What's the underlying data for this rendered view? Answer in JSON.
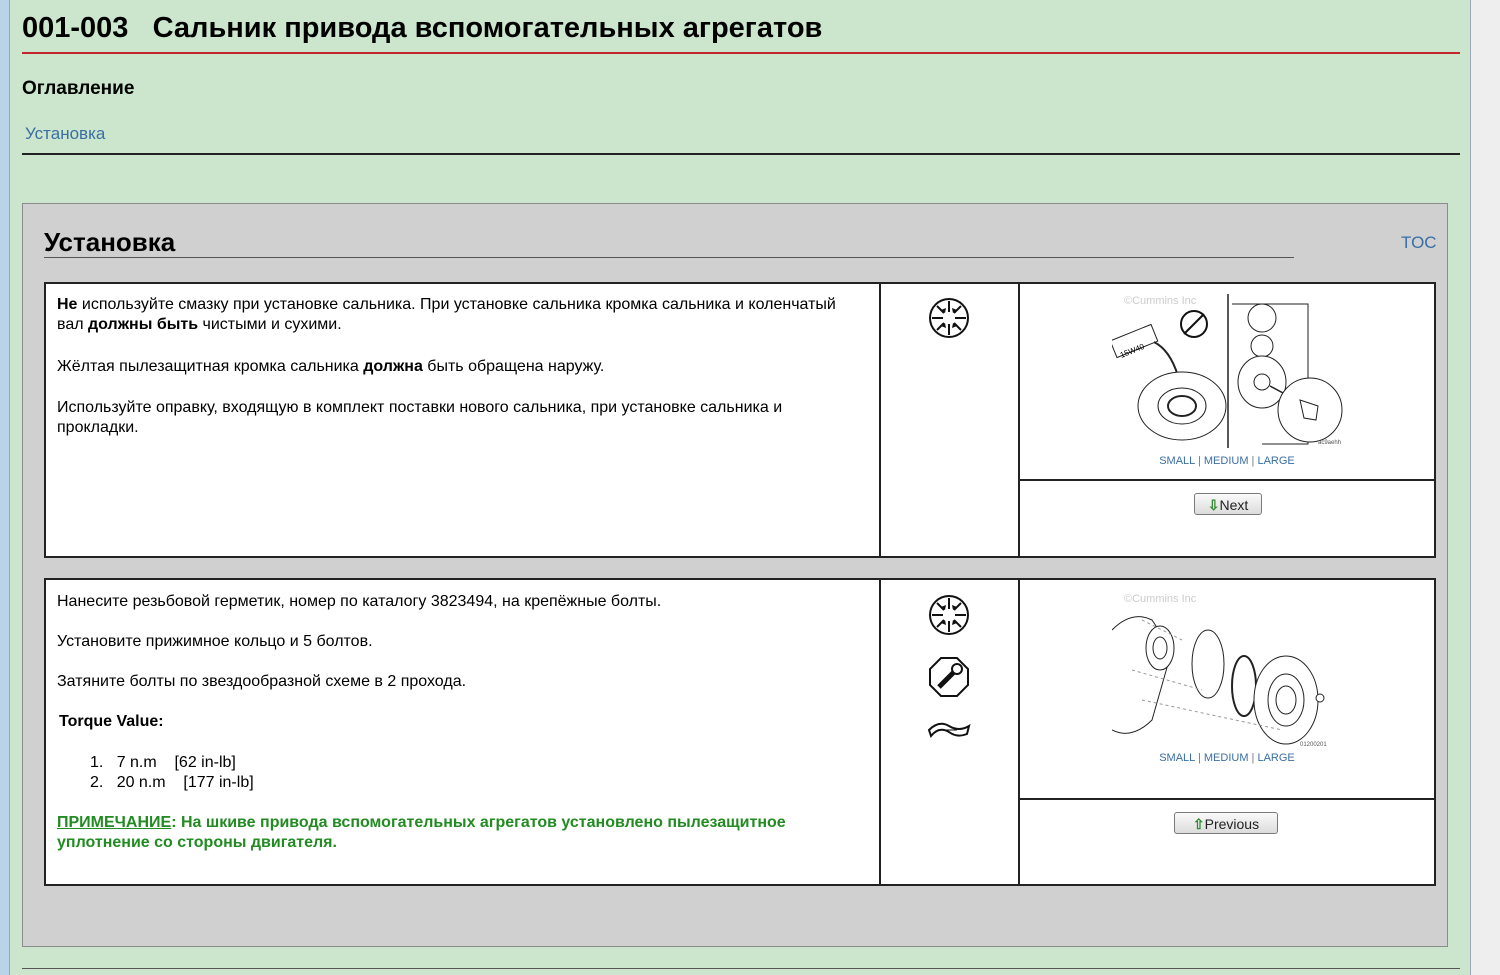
{
  "document": {
    "title_code": "001-003",
    "title_text": "Сальник привода вспомогательных агрегатов",
    "toc_heading": "Оглавление",
    "toc_links": [
      "Установка"
    ]
  },
  "section": {
    "title": "Установка",
    "toc_link": "TOC",
    "size_links": {
      "small": "SMALL",
      "medium": "MEDIUM",
      "large": "LARGE",
      "separator": "|"
    },
    "watermark": "©Cummins Inc",
    "steps": [
      {
        "paragraphs": [
          {
            "bold_start": "Не",
            "text": " используйте смазку при установке сальника. При установке сальника кромка сальника и коленчатый вал ",
            "bold_mid": "должны быть",
            "text_end": " чистыми и сухими."
          },
          {
            "text": "Жёлтая пылезащитная кромка сальника ",
            "bold_mid": "должна",
            "text_end": " быть обращена наружу."
          },
          {
            "text": "Используйте оправку, входящую в комплект поставки нового сальника, при установке сальника и прокладки."
          }
        ],
        "icons": [
          "parts-puzzle-icon"
        ],
        "image_label": "15W40",
        "image_code": "ac9aehh",
        "nav_button": "Next"
      },
      {
        "paragraphs": [
          {
            "text": "Нанесите резьбовой герметик, номер по каталогу 3823494, на крепёжные болты."
          },
          {
            "text": "Установите прижимное кольцо и 5 болтов."
          },
          {
            "text": "Затяните болты по звездообразной схеме в 2 прохода."
          }
        ],
        "torque_title": "Torque Value:",
        "torque_values": [
          {
            "num": "1.",
            "metric": "7 n.m",
            "imperial": "[62 in-lb]"
          },
          {
            "num": "2.",
            "metric": "20 n.m",
            "imperial": "[177 in-lb]"
          }
        ],
        "note_label": "ПРИМЕЧАНИЕ",
        "note_text": ": На шкиве привода вспомогательных агрегатов установлено пылезащитное уплотнение со стороны двигателя.",
        "icons": [
          "parts-puzzle-icon",
          "torque-wrench-icon",
          "sealant-icon"
        ],
        "image_code": "01200201",
        "nav_button": "Previous"
      }
    ]
  }
}
